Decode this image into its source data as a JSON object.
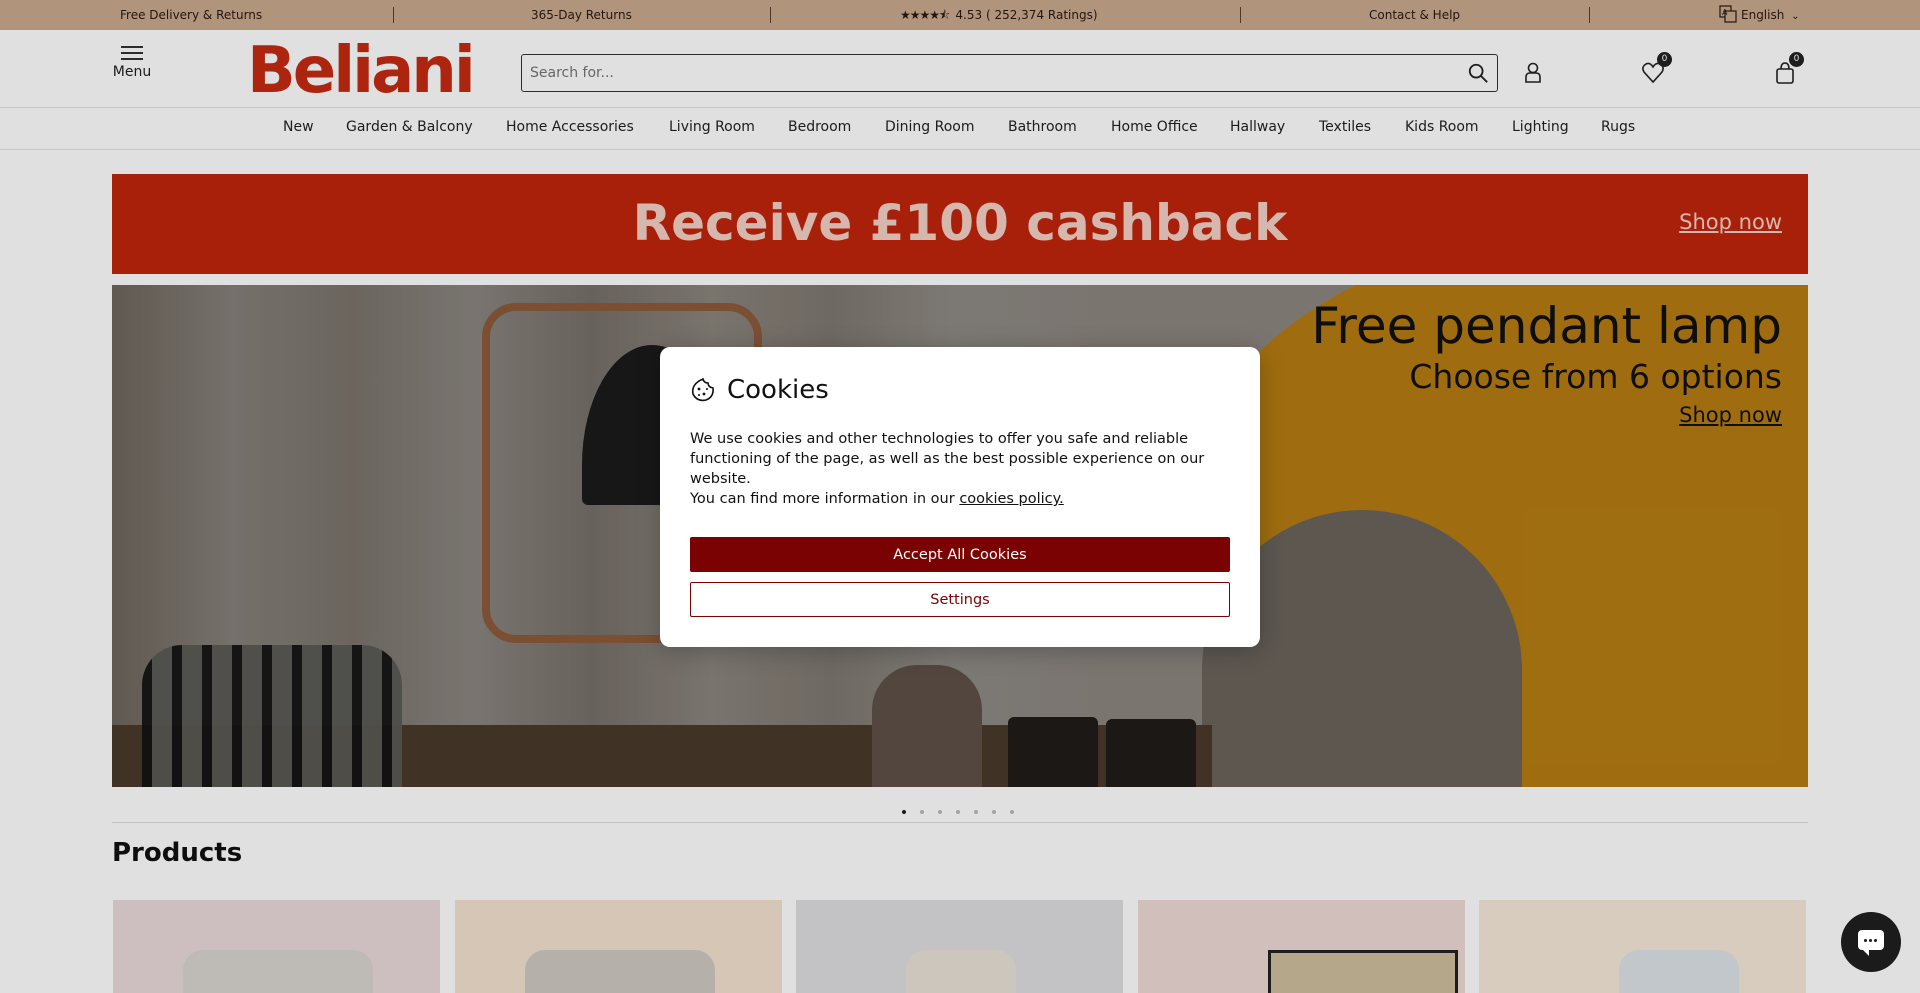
{
  "topbar": {
    "delivery": "Free Delivery & Returns",
    "returns": "365-Day Returns",
    "rating_stars_icon": "star-rating-icon",
    "rating_value": "4.53",
    "rating_count": "( 252,374 Ratings)",
    "contact": "Contact & Help",
    "language": "English"
  },
  "header": {
    "menu_label": "Menu",
    "logo_text": "Beliani",
    "search_placeholder": "Search for...",
    "wishlist_count": "0",
    "cart_count": "0"
  },
  "nav": {
    "items": [
      "New",
      "Garden & Balcony",
      "Home Accessories",
      "Living Room",
      "Bedroom",
      "Dining Room",
      "Bathroom",
      "Home Office",
      "Hallway",
      "Textiles",
      "Kids Room",
      "Lighting",
      "Rugs"
    ]
  },
  "promo": {
    "title": "Receive £100 cashback",
    "cta": "Shop now",
    "color": "#c1250c"
  },
  "hero": {
    "headline": "Free pendant lamp",
    "subheadline": "Choose from 6 options",
    "cta": "Shop now",
    "slide_count": 7,
    "active_slide": 1
  },
  "products": {
    "title": "Products"
  },
  "cookie_modal": {
    "icon": "cookie-icon",
    "title": "Cookies",
    "body": "We use cookies and other technologies to offer you safe and reliable functioning of the page, as well as the best possible experience on our website.",
    "policy_prefix": "You can find more information in our ",
    "policy_link": "cookies policy.",
    "accept_label": "Accept All Cookies",
    "settings_label": "Settings",
    "accent_color": "#7b0202"
  }
}
